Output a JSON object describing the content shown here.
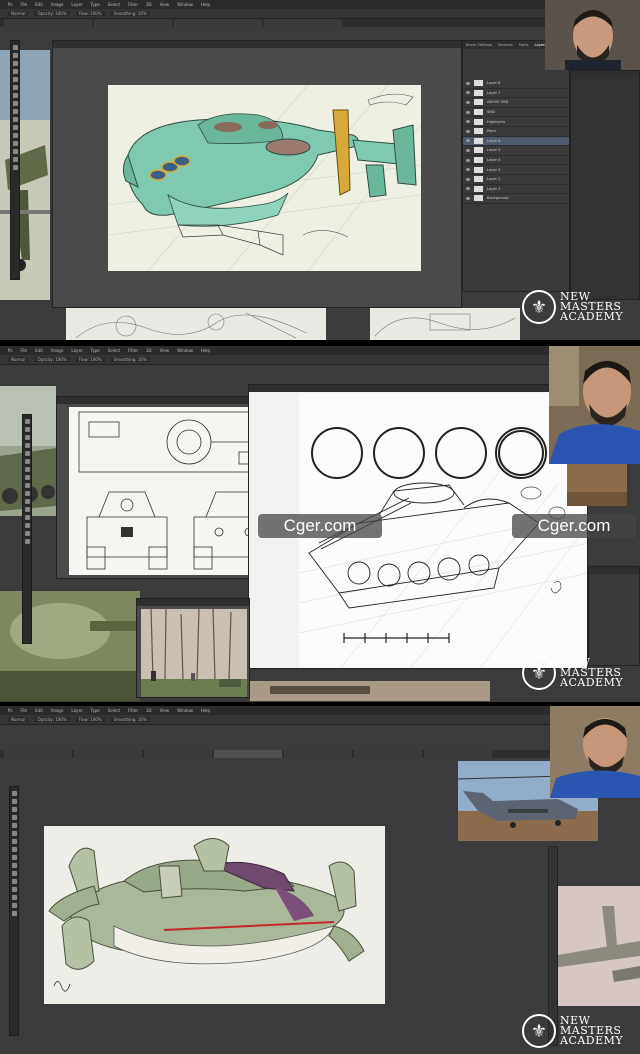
{
  "menu": [
    "Ps",
    "File",
    "Edit",
    "Image",
    "Layer",
    "Type",
    "Select",
    "Filter",
    "3D",
    "View",
    "Window",
    "Help"
  ],
  "options": [
    "Normal",
    "Opacity: 100%",
    "Flow: 100%",
    "Smoothing: 10%"
  ],
  "panel1": {
    "tabs": [
      "Brush Settings",
      "Brushes",
      "Paths",
      "Layers"
    ],
    "layers": [
      "Layer 8",
      "Layer 7",
      "ABOVE SHD",
      "SHD",
      "Highlights",
      "Paint",
      "Layer 6",
      "Layer 5",
      "Layer 4",
      "Layer 3",
      "Layer 2",
      "Layer 1",
      "Background"
    ],
    "selected": 6
  },
  "watermark": {
    "text": "Cger.com"
  },
  "logo": {
    "line1": "NEW",
    "line2": "MASTERS",
    "line3": "ACADEMY",
    "glyph": "⚜"
  },
  "colors": {
    "ui_bg": "#3b3b3b",
    "ship_green": "#7fc9b0",
    "accent_yellow": "#d6a93a",
    "sky": "#a9b7c2"
  }
}
